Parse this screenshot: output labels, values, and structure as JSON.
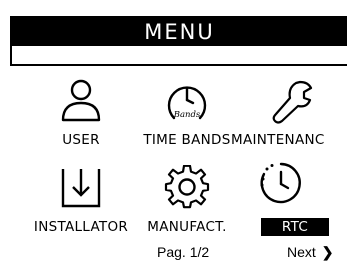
{
  "header": {
    "title": "MENU"
  },
  "menu": {
    "items": [
      {
        "label": "USER",
        "icon": "user-icon"
      },
      {
        "label": "TIME BANDS",
        "icon": "time-bands-icon",
        "icon_text": "Bands"
      },
      {
        "label": "MAINTENANC",
        "icon": "wrench-icon"
      },
      {
        "label": "INSTALLATOR",
        "icon": "download-box-icon"
      },
      {
        "label": "MANUFACT.",
        "icon": "gear-icon"
      },
      {
        "label": "RTC",
        "icon": "clock-icon",
        "selected": true
      }
    ]
  },
  "footer": {
    "page_label": "Pag. 1/2",
    "next_label": "Next",
    "next_icon": "chevron-right-icon"
  }
}
